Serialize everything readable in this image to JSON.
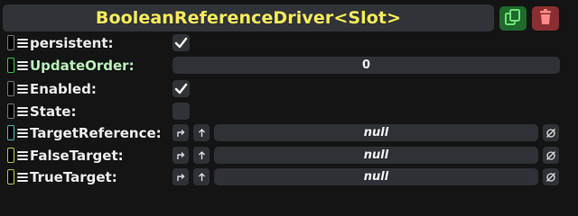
{
  "header": {
    "title": "BooleanReferenceDriver<Slot>",
    "duplicate_icon": "duplicate-icon",
    "delete_icon": "trash-icon",
    "duplicate_color": "#1f6a2c",
    "delete_color": "#8a2e32",
    "title_color": "#f6eb5a"
  },
  "fields": {
    "persistent": {
      "label": "persistent:",
      "checked": true,
      "handle_color": "#777777"
    },
    "update_order": {
      "label": "UpdateOrder:",
      "value": "0",
      "handle_color": "#3fbf4a"
    },
    "enabled": {
      "label": "Enabled:",
      "checked": true,
      "handle_color": "#777777"
    },
    "state": {
      "label": "State:",
      "checked": false,
      "handle_color": "#777777"
    },
    "target_reference": {
      "label": "TargetReference:",
      "value": "null",
      "handle_color": "#4fb7b7"
    },
    "false_target": {
      "label": "FalseTarget:",
      "value": "null",
      "handle_color": "#b8c44a"
    },
    "true_target": {
      "label": "TrueTarget:",
      "value": "null",
      "handle_color": "#b8c44a"
    }
  },
  "icons": {
    "checkmark": "checkmark-icon",
    "menu": "hamburger-menu-icon",
    "jump": "jump-to-icon",
    "up": "arrow-up-icon",
    "clear": "null-clear-icon"
  }
}
